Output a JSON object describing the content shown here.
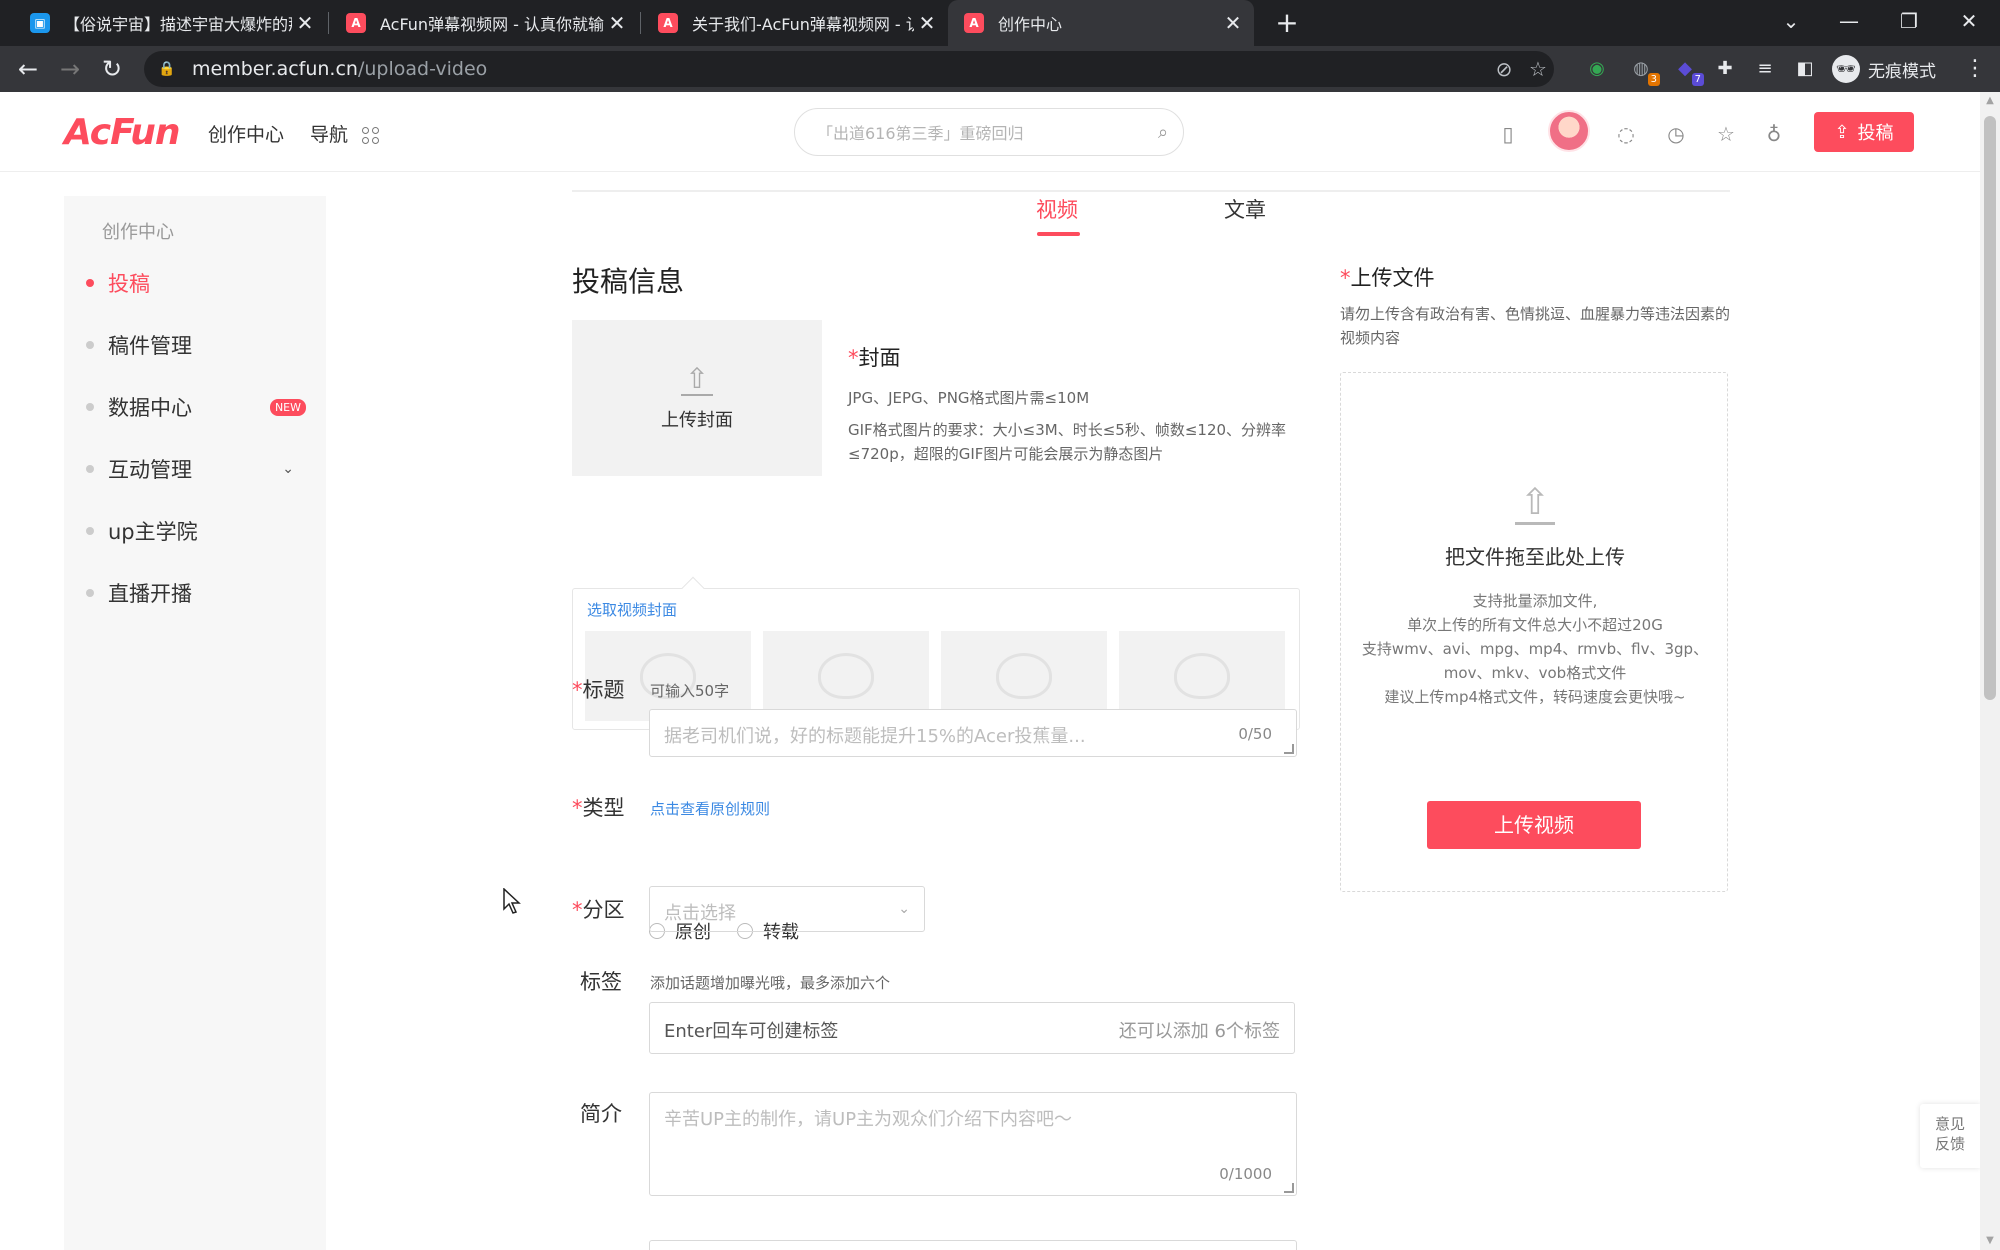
{
  "browser": {
    "tabs": [
      {
        "title": "【俗说宇宙】描述宇宙大爆炸的那",
        "favicon_color": "#1b97ed"
      },
      {
        "title": "AcFun弹幕视频网 - 认真你就输啦",
        "favicon_color": "#fd4c5d"
      },
      {
        "title": "关于我们-AcFun弹幕视频网 - 认",
        "favicon_color": "#fd4c5d"
      },
      {
        "title": "创作中心",
        "favicon_color": "#fd4c5d"
      }
    ],
    "url_domain": "member.acfun.cn",
    "url_path": "/upload-video",
    "ext_badges": [
      "3",
      "7"
    ],
    "incognito_label": "无痕模式"
  },
  "header": {
    "logo": "AcFun",
    "nav_creator": "创作中心",
    "nav_guide": "导航",
    "search_placeholder": "「出道616第三季」重磅回归",
    "post_button": "投稿"
  },
  "sidebar": {
    "title": "创作中心",
    "items": [
      {
        "label": "投稿"
      },
      {
        "label": "稿件管理"
      },
      {
        "label": "数据中心",
        "badge": "NEW"
      },
      {
        "label": "互动管理"
      },
      {
        "label": "up主学院"
      },
      {
        "label": "直播开播"
      }
    ]
  },
  "content_tabs": [
    "视频",
    "文章"
  ],
  "form": {
    "section_title": "投稿信息",
    "cover": {
      "upload_label": "上传封面",
      "required_mark": "*",
      "title": "封面",
      "line1": "JPG、JEPG、PNG格式图片需≤10M",
      "line2": "GIF格式图片的要求：大小≤3M、时长≤5秒、帧数≤120、分辨率≤720p，超限的GIF图片可能会展示为静态图片",
      "pick_frame_link": "选取视频封面"
    },
    "title_field": {
      "label": "标题",
      "hint": "可输入50字",
      "placeholder": "据老司机们说，好的标题能提升15%的Acer投蕉量...",
      "count": "0/50"
    },
    "type_field": {
      "label": "类型",
      "link": "点击查看原创规则",
      "options": [
        "原创",
        "转载"
      ]
    },
    "zone_field": {
      "label": "分区",
      "placeholder": "点击选择"
    },
    "tags_field": {
      "label": "标签",
      "hint": "添加话题增加曝光哦，最多添加六个",
      "placeholder": "Enter回车可创建标签",
      "remaining": "还可以添加 6个标签"
    },
    "intro_field": {
      "label": "简介",
      "placeholder": "辛苦UP主的制作，请UP主为观众们介绍下内容吧～",
      "count": "0/1000"
    }
  },
  "upload": {
    "required_mark": "*",
    "title": "上传文件",
    "warning": "请勿上传含有政治有害、色情挑逗、血腥暴力等违法因素的视频内容",
    "drop_title": "把文件拖至此处上传",
    "lines": [
      "支持批量添加文件,",
      "单次上传的所有文件总大小不超过20G",
      "支持wmv、avi、mpg、mp4、rmvb、flv、3gp、",
      "mov、mkv、vob格式文件",
      "建议上传mp4格式文件，转码速度会更快哦~"
    ],
    "button": "上传视频"
  },
  "feedback": {
    "line1": "意见",
    "line2": "反馈"
  },
  "colors": {
    "accent": "#fd4c5d",
    "link": "#3b89e3"
  }
}
